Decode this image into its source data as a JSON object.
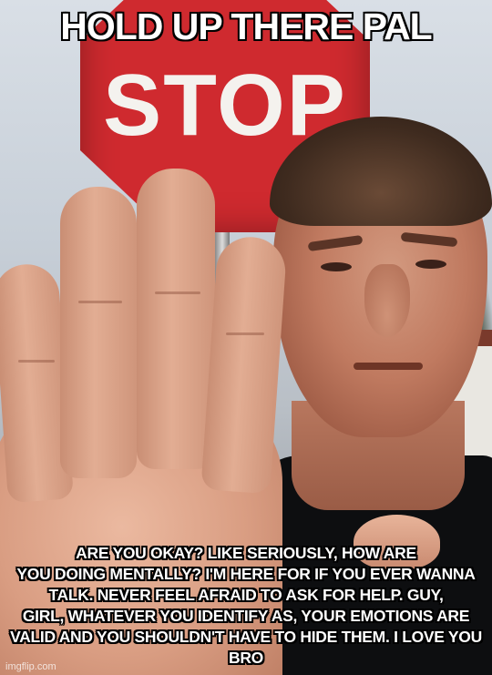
{
  "meme": {
    "top_text": "HOLD UP THERE PAL",
    "bottom_text": "ARE YOU OKAY? LIKE SERIOUSLY, HOW ARE\nYOU DOING MENTALLY? I'M HERE FOR IF YOU EVER WANNA\nTALK. NEVER FEEL AFRAID TO ASK FOR HELP. GUY,\nGIRL, WHATEVER YOU IDENTIFY AS, YOUR EMOTIONS ARE\nVALID AND YOU SHOULDN'T HAVE TO HIDE THEM. I LOVE YOU BRO",
    "watermark": "imgflip.com"
  },
  "photo": {
    "sign_text": "STOP",
    "sign_color": "#cf2a2f"
  }
}
